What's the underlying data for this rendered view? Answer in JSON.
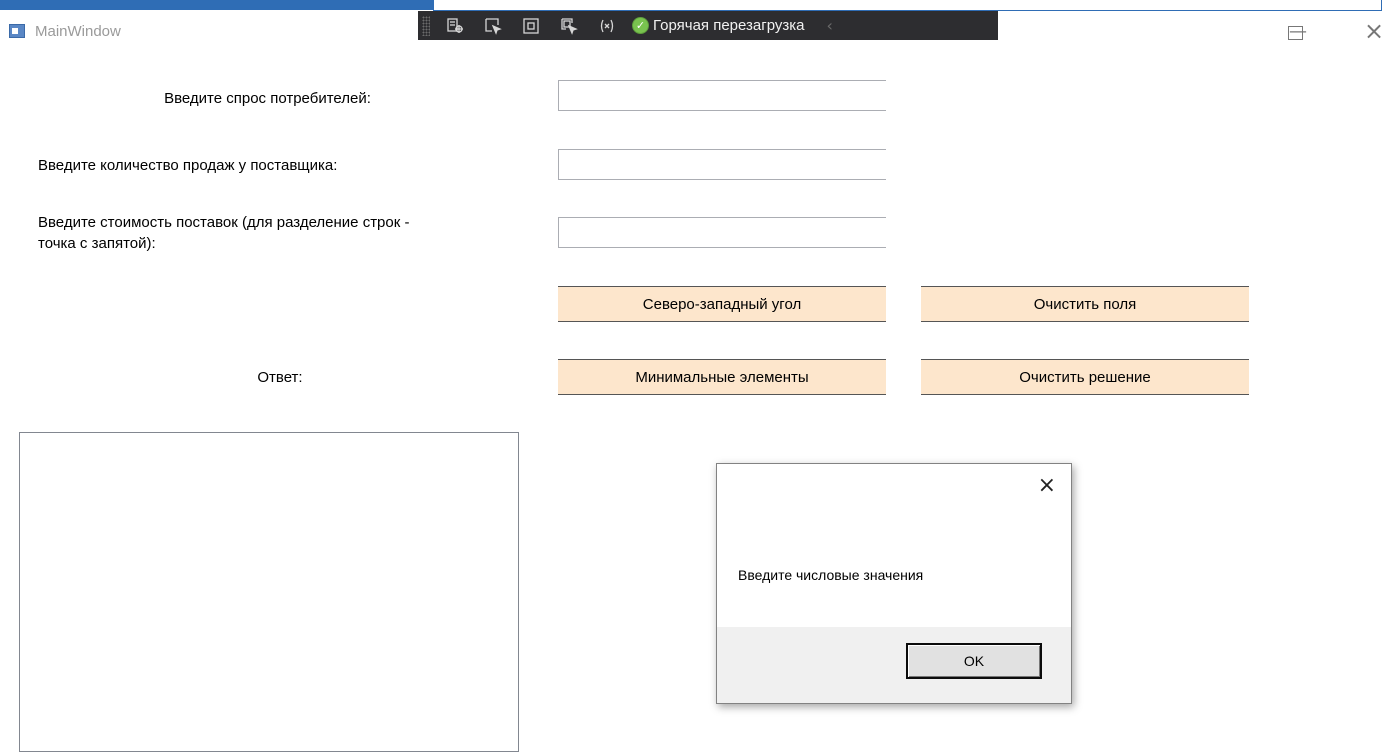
{
  "window": {
    "title": "MainWindow",
    "minimize": "—",
    "close": "×"
  },
  "debug_toolbar": {
    "hot_reload_label": "Горячая перезагрузка",
    "collapse": "‹"
  },
  "form": {
    "demand_label": "Введите спрос потребителей:",
    "demand_value": "",
    "sales_label": "Введите количество продаж у поставщика:",
    "sales_value": "",
    "cost_label": "Введите стоимость поставок (для разделение строк - точка с запятой):",
    "cost_value": "",
    "answer_label": "Ответ:"
  },
  "buttons": {
    "northwest": "Северо-западный угол",
    "clear_fields": "Очистить поля",
    "min_elements": "Минимальные элементы",
    "clear_solution": "Очистить решение"
  },
  "message_box": {
    "text": "Введите числовые значения",
    "ok": "OK",
    "close": "×"
  },
  "colors": {
    "accent": "#2f6db5",
    "button_bg": "#fde6cc",
    "toolbar_bg": "#2d2d30",
    "hot_reload_ok": "#79c34f"
  }
}
